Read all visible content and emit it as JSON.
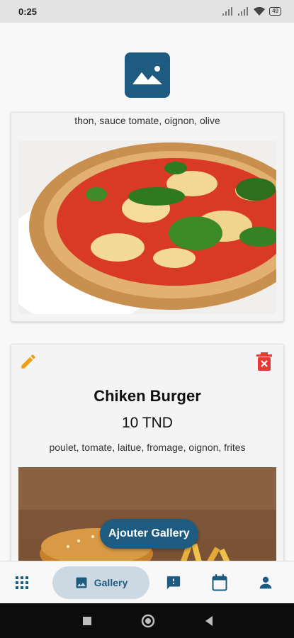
{
  "status_bar": {
    "time": "0:25",
    "battery": "49"
  },
  "gallery_items": [
    {
      "ingredients": "thon, sauce tomate, oignon, olive",
      "image": "pizza-photo"
    },
    {
      "name": "Chiken Burger",
      "price": "10 TND",
      "ingredients": "poulet, tomate, laitue, fromage, oignon, frites",
      "image": "burger-photo"
    }
  ],
  "fab": {
    "label": "Ajouter Gallery"
  },
  "bottom_nav": {
    "items": [
      {
        "icon": "apps-grid-icon"
      },
      {
        "icon": "image-icon",
        "label": "Gallery",
        "active": true
      },
      {
        "icon": "feedback-icon"
      },
      {
        "icon": "calendar-icon"
      },
      {
        "icon": "person-icon"
      }
    ]
  },
  "colors": {
    "primary": "#1d5b80",
    "edit": "#f0a013",
    "delete": "#e53935",
    "nav_active_bg": "#cdd9e2"
  }
}
